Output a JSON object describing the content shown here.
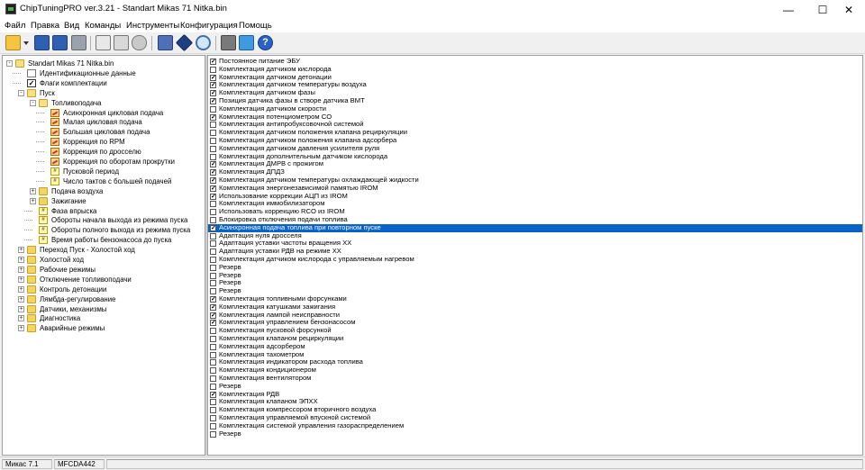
{
  "window": {
    "title": "ChipTuningPRO ver.3.21 - Standart Mikas 71 Nitka.bin",
    "controls": {
      "minimize": "—",
      "maximize": "☐",
      "close": "✕"
    }
  },
  "menu": [
    "Файл",
    "Правка",
    "Вид",
    "Команды",
    "Инструменты",
    "Конфигурация",
    "Помощь"
  ],
  "toolbar": {
    "buttons": [
      "open-icon",
      "dropdown-arrow-icon",
      "save-icon",
      "save-as-icon",
      "print-icon",
      "copy-icon",
      "paste-icon",
      "undo-icon",
      "calculator-icon",
      "diamond-icon",
      "search-icon",
      "tools-icon",
      "monitor-icon",
      "help-icon"
    ]
  },
  "tree": [
    {
      "label": "Standart Mikas 71 Nitka.bin",
      "level": 0,
      "icon": "folder-open",
      "toggle": "-"
    },
    {
      "label": "Идентификационные данные",
      "level": 1,
      "icon": "doc",
      "toggle": ""
    },
    {
      "label": "Флаги комплектации",
      "level": 1,
      "icon": "check",
      "toggle": ""
    },
    {
      "label": "Пуск",
      "level": 1,
      "icon": "folder-open",
      "toggle": "-"
    },
    {
      "label": "Топливоподача",
      "level": 2,
      "icon": "folder-open",
      "toggle": "-"
    },
    {
      "label": "Асинхронная цикловая подача",
      "level": 3,
      "icon": "map",
      "toggle": ""
    },
    {
      "label": "Малая цикловая подача",
      "level": 3,
      "icon": "map",
      "toggle": ""
    },
    {
      "label": "Большая цикловая подача",
      "level": 3,
      "icon": "map",
      "toggle": ""
    },
    {
      "label": "Коррекция по RPM",
      "level": 3,
      "icon": "map",
      "toggle": ""
    },
    {
      "label": "Коррекция по дросселю",
      "level": 3,
      "icon": "map",
      "toggle": ""
    },
    {
      "label": "Коррекция по оборотам прокрутки",
      "level": 3,
      "icon": "map",
      "toggle": ""
    },
    {
      "label": "Пусковой период",
      "level": 3,
      "icon": "num",
      "toggle": ""
    },
    {
      "label": "Число тактов с большей подачей",
      "level": 3,
      "icon": "num",
      "toggle": ""
    },
    {
      "label": "Подача воздуха",
      "level": 2,
      "icon": "folder",
      "toggle": "+"
    },
    {
      "label": "Зажигание",
      "level": 2,
      "icon": "folder",
      "toggle": "+"
    },
    {
      "label": "Фаза впрыска",
      "level": 2,
      "icon": "num",
      "toggle": ""
    },
    {
      "label": "Обороты начала выхода из режима пуска",
      "level": 2,
      "icon": "num",
      "toggle": ""
    },
    {
      "label": "Обороты полного выхода из режима пуска",
      "level": 2,
      "icon": "num",
      "toggle": ""
    },
    {
      "label": "Время работы бензонасоса до пуска",
      "level": 2,
      "icon": "num",
      "toggle": ""
    },
    {
      "label": "Переход Пуск - Холостой ход",
      "level": 1,
      "icon": "folder",
      "toggle": "+"
    },
    {
      "label": "Холостой ход",
      "level": 1,
      "icon": "folder",
      "toggle": "+"
    },
    {
      "label": "Рабочие режимы",
      "level": 1,
      "icon": "folder",
      "toggle": "+"
    },
    {
      "label": "Отключение топливоподачи",
      "level": 1,
      "icon": "folder",
      "toggle": "+"
    },
    {
      "label": "Контроль детонации",
      "level": 1,
      "icon": "folder",
      "toggle": "+"
    },
    {
      "label": "Лямбда-регулирование",
      "level": 1,
      "icon": "folder",
      "toggle": "+"
    },
    {
      "label": "Датчики, механизмы",
      "level": 1,
      "icon": "folder",
      "toggle": "+"
    },
    {
      "label": "Диагностика",
      "level": 1,
      "icon": "folder",
      "toggle": "+"
    },
    {
      "label": "Аварийные режимы",
      "level": 1,
      "icon": "folder",
      "toggle": "+"
    }
  ],
  "flags": [
    {
      "label": "Постоянное питание ЭБУ",
      "checked": true
    },
    {
      "label": "Комплектация датчиком кислорода",
      "checked": false
    },
    {
      "label": "Комплектация датчиком детонации",
      "checked": true
    },
    {
      "label": "Комплектация датчиком температуры воздуха",
      "checked": true
    },
    {
      "label": "Комплектация датчиком фазы",
      "checked": true
    },
    {
      "label": "Позиция датчика фазы в створе датчика ВМТ",
      "checked": true
    },
    {
      "label": "Комплектация датчиком скорости",
      "checked": false
    },
    {
      "label": "Комплектация потенциометром CO",
      "checked": true
    },
    {
      "label": "Комплектация антипробуксовочной системой",
      "checked": false
    },
    {
      "label": "Комплектация датчиком положения клапана рециркуляции",
      "checked": false
    },
    {
      "label": "Комплектация датчиком положения клапана адсорбера",
      "checked": false
    },
    {
      "label": "Комплектация датчиком давления усилителя руля",
      "checked": false
    },
    {
      "label": "Комплектация дополнительным датчиком кислорода",
      "checked": false
    },
    {
      "label": "Комплектация ДМРВ с прожигом",
      "checked": true
    },
    {
      "label": "Комплектация ДПДЗ",
      "checked": true
    },
    {
      "label": "Комплектация датчиком температуры охлаждающей жидкости",
      "checked": true
    },
    {
      "label": "Комплектация энергонезависимой памятью IROM",
      "checked": true
    },
    {
      "label": "Использование коррекции АЦП из IROM",
      "checked": true
    },
    {
      "label": "Комплектация иммобилизатором",
      "checked": false
    },
    {
      "label": "Использовать коррекцию RCO из IROM",
      "checked": false
    },
    {
      "label": "Блокировка отключения подачи топлива",
      "checked": false
    },
    {
      "label": "Асинхронная подача топлива при повторном пуске",
      "checked": true,
      "selected": true
    },
    {
      "label": "Адаптация нуля дросселя",
      "checked": false
    },
    {
      "label": "Адаптация уставки частоты вращения ХХ",
      "checked": false
    },
    {
      "label": "Адаптация уставки РДВ на режиме ХХ",
      "checked": false
    },
    {
      "label": "Комплектация датчиком кислорода с управляемым нагревом",
      "checked": false
    },
    {
      "label": "Резерв",
      "checked": false
    },
    {
      "label": "Резерв",
      "checked": false
    },
    {
      "label": "Резерв",
      "checked": false
    },
    {
      "label": "Резерв",
      "checked": false
    },
    {
      "label": "Комплектация топливными форсунками",
      "checked": true
    },
    {
      "label": "Комплектация катушками зажигания",
      "checked": true
    },
    {
      "label": "Комплектация лампой неисправности",
      "checked": true
    },
    {
      "label": "Комплектация управлением бензонасосом",
      "checked": true
    },
    {
      "label": "Комплектация пусковой форсункой",
      "checked": false
    },
    {
      "label": "Комплектация клапаном рециркуляции",
      "checked": false
    },
    {
      "label": "Комплектация адсорбером",
      "checked": false
    },
    {
      "label": "Комплектация тахометром",
      "checked": false
    },
    {
      "label": "Комплектация индикатором расхода топлива",
      "checked": false
    },
    {
      "label": "Комплектация кондиционером",
      "checked": false
    },
    {
      "label": "Комплектация вентилятором",
      "checked": false
    },
    {
      "label": "Резерв",
      "checked": false
    },
    {
      "label": "Комплектация РДВ",
      "checked": true
    },
    {
      "label": "Комплектация клапаном ЭПХХ",
      "checked": false
    },
    {
      "label": "Комплектация компрессором вторичного воздуха",
      "checked": false
    },
    {
      "label": "Комплектация управляемой впускной системой",
      "checked": false
    },
    {
      "label": "Комплектация системой управления газораспределением",
      "checked": false
    },
    {
      "label": "Резерв",
      "checked": false
    }
  ],
  "status": {
    "cell1": "Микас 7.1",
    "cell2": "MFCDA442",
    "cell3": ""
  },
  "colors": {
    "selection": "#0a64c8",
    "window_bg": "#f0f0f0"
  }
}
